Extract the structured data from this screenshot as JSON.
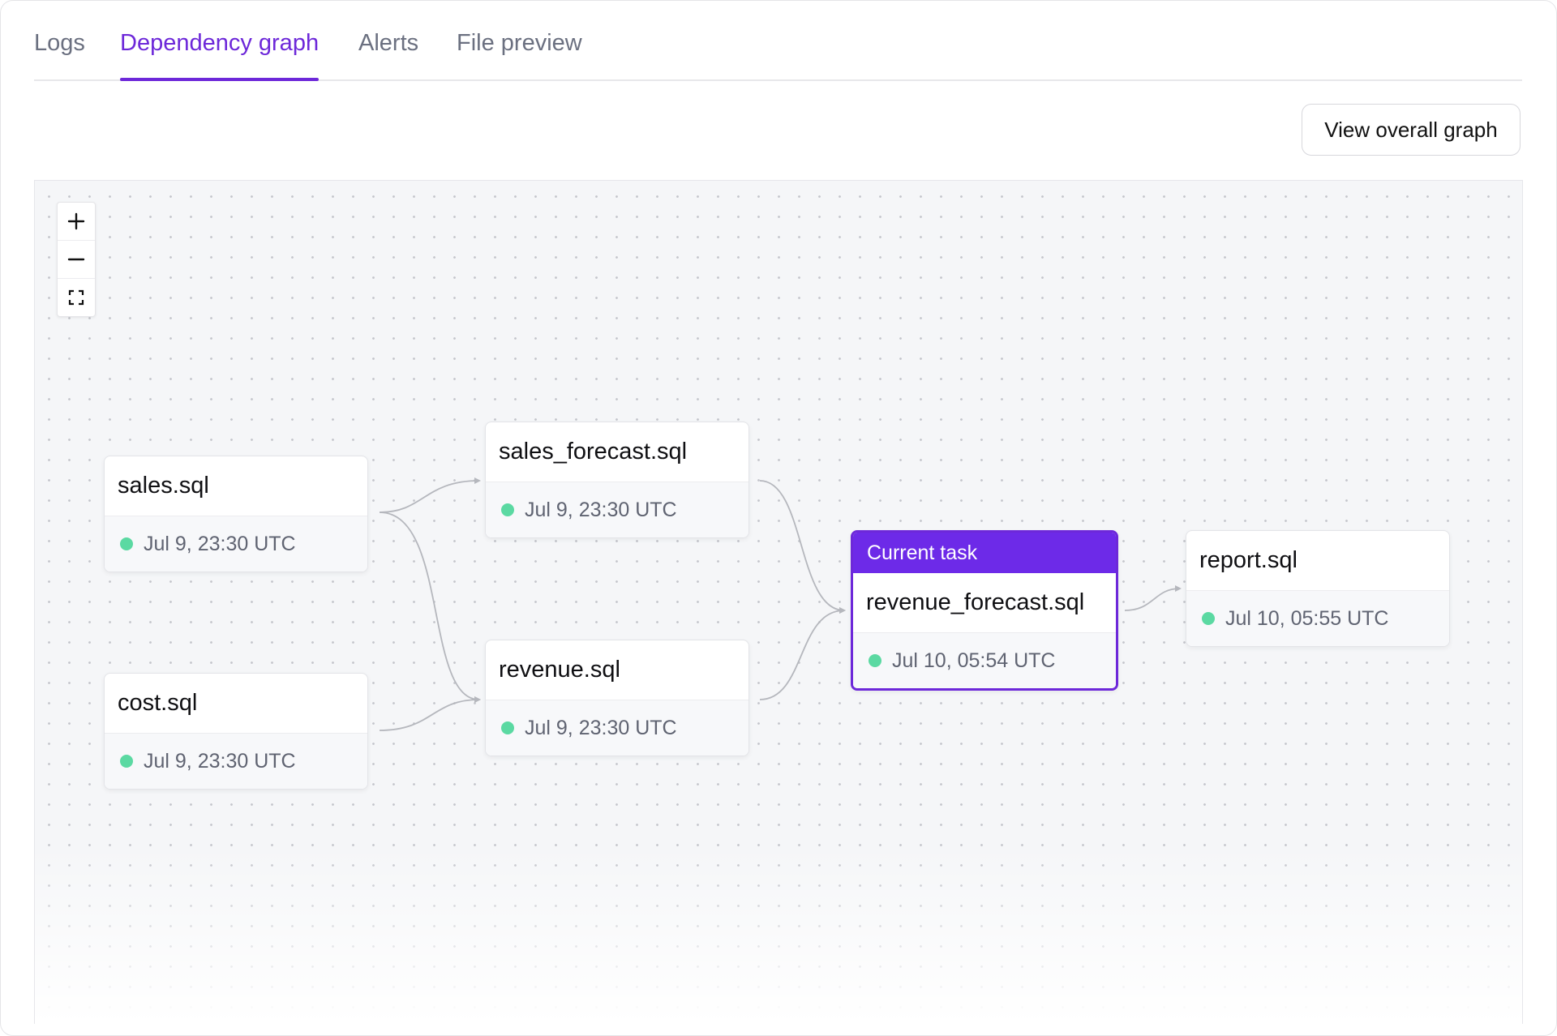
{
  "tabs": [
    {
      "label": "Logs",
      "active": false
    },
    {
      "label": "Dependency graph",
      "active": true
    },
    {
      "label": "Alerts",
      "active": false
    },
    {
      "label": "File preview",
      "active": false
    }
  ],
  "toolbar": {
    "view_overall_label": "View overall graph"
  },
  "zoom_controls": {
    "zoom_in_icon": "plus-icon",
    "zoom_out_icon": "minus-icon",
    "fit_icon": "fit-view-icon"
  },
  "colors": {
    "accent": "#6d28d9",
    "status_success": "#5bd9a2",
    "edge": "#b5b7bd"
  },
  "graph": {
    "current_task_label": "Current task",
    "nodes": {
      "sales": {
        "name": "sales.sql",
        "timestamp": "Jul 9, 23:30 UTC",
        "status": "success"
      },
      "cost": {
        "name": "cost.sql",
        "timestamp": "Jul 9, 23:30 UTC",
        "status": "success"
      },
      "sales_forecast": {
        "name": "sales_forecast.sql",
        "timestamp": "Jul 9, 23:30 UTC",
        "status": "success"
      },
      "revenue": {
        "name": "revenue.sql",
        "timestamp": "Jul 9, 23:30 UTC",
        "status": "success"
      },
      "revenue_forecast": {
        "name": "revenue_forecast.sql",
        "timestamp": "Jul 10, 05:54 UTC",
        "status": "success",
        "current": true
      },
      "report": {
        "name": "report.sql",
        "timestamp": "Jul 10, 05:55 UTC",
        "status": "success"
      }
    },
    "edges": [
      [
        "sales",
        "sales_forecast"
      ],
      [
        "sales",
        "revenue"
      ],
      [
        "cost",
        "revenue"
      ],
      [
        "sales_forecast",
        "revenue_forecast"
      ],
      [
        "revenue",
        "revenue_forecast"
      ],
      [
        "revenue_forecast",
        "report"
      ]
    ]
  }
}
